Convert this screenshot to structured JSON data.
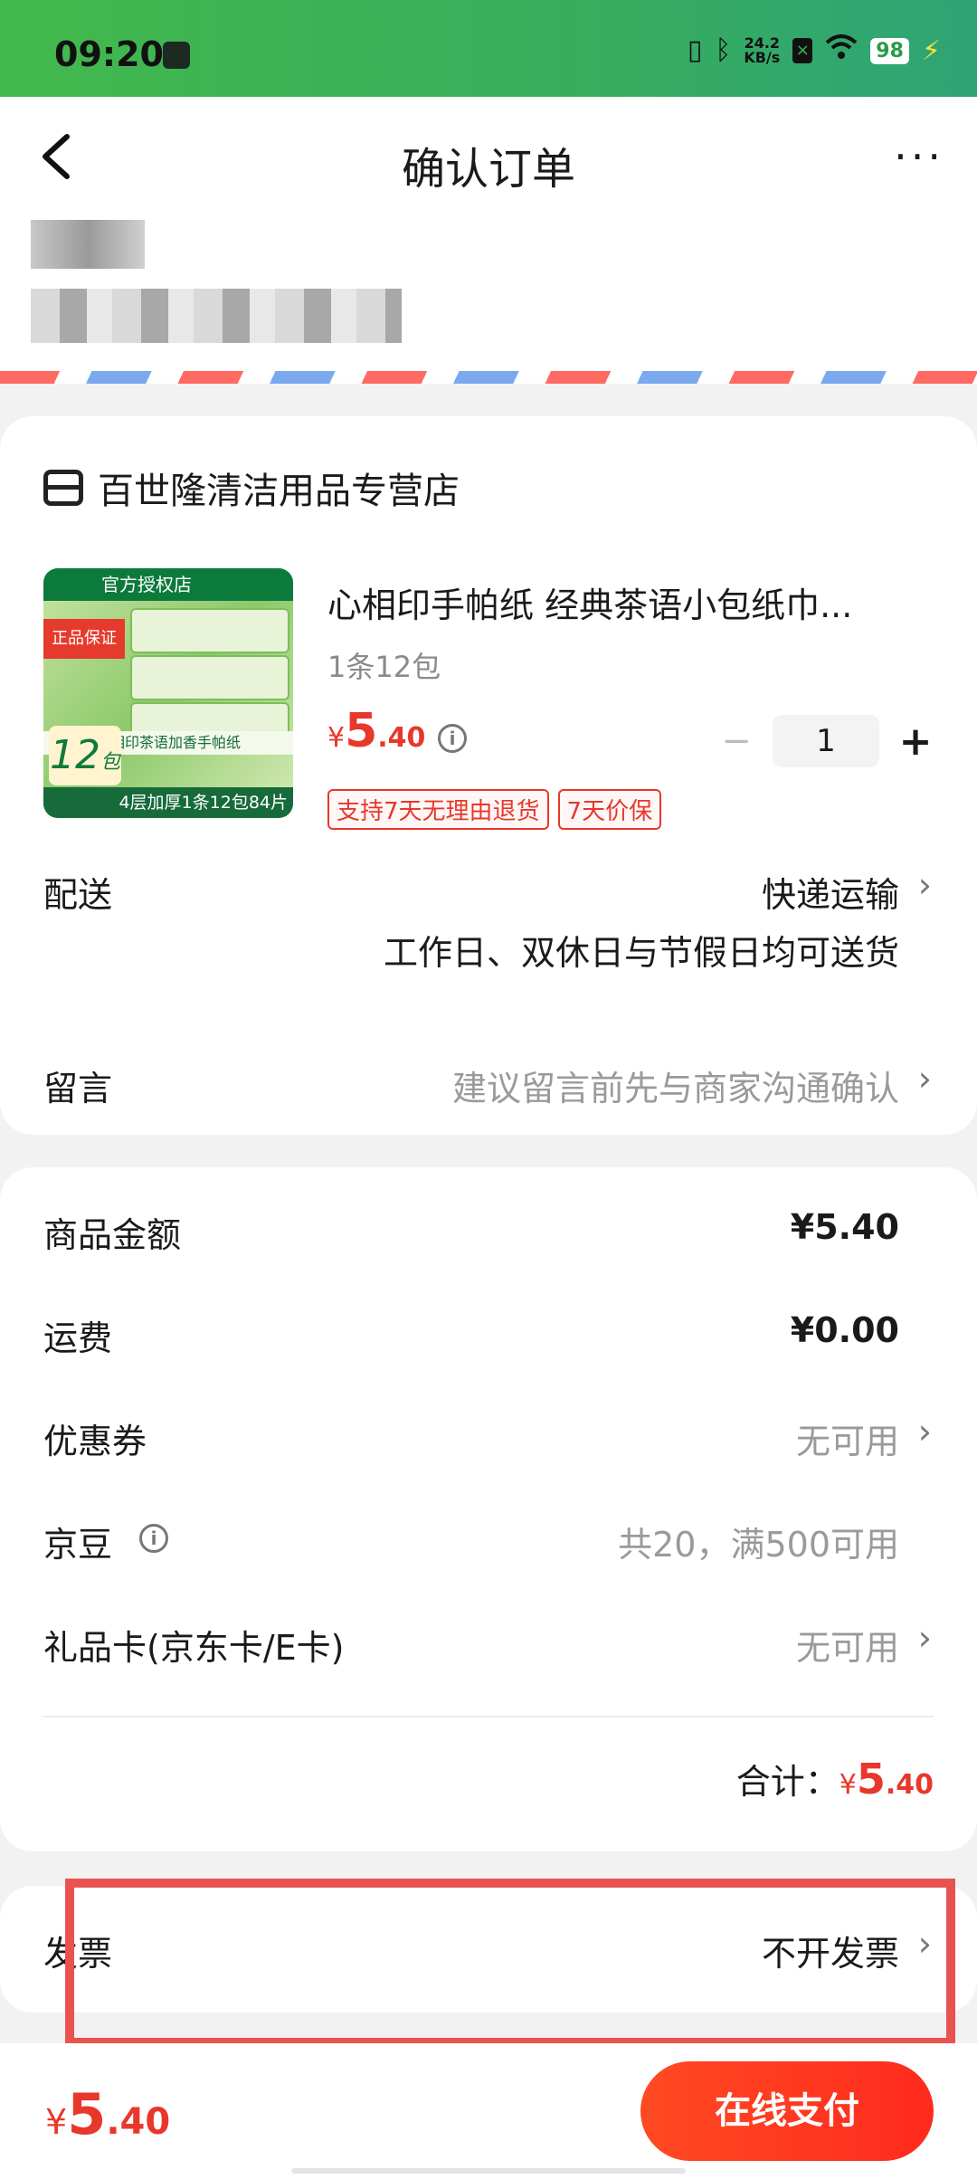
{
  "status_bar": {
    "time": "09:20",
    "net_speed_value": "24.2",
    "net_speed_unit": "KB/s",
    "battery": "98",
    "icons": [
      "vibrate-icon",
      "bluetooth-icon",
      "signal-x-icon",
      "wifi-icon",
      "battery-icon",
      "charging-icon"
    ]
  },
  "header": {
    "title": "确认订单",
    "more_label": "···"
  },
  "store": {
    "name": "百世隆清洁用品专营店"
  },
  "product": {
    "title": "心相印手帕纸 经典茶语小包纸巾...",
    "spec": "1条12包",
    "price_symbol": "¥",
    "price_int": "5",
    "price_dec": ".40",
    "quantity": "1",
    "minus": "−",
    "plus": "+",
    "tags": [
      "支持7天无理由退货",
      "7天价保"
    ],
    "image_text": {
      "top_badge": "官方授权店",
      "red_badge": "正品保证",
      "count": "12",
      "count_unit": "包",
      "line": "心相印茶语加香手帕纸",
      "bottom": "4层加厚1条12包84片"
    }
  },
  "delivery": {
    "label": "配送",
    "method": "快递运输",
    "note": "工作日、双休日与节假日均可送货"
  },
  "message": {
    "label": "留言",
    "placeholder": "建议留言前先与商家沟通确认"
  },
  "summary": {
    "goods_amount_label": "商品金额",
    "goods_amount": "¥5.40",
    "shipping_label": "运费",
    "shipping": "¥0.00",
    "coupon_label": "优惠券",
    "coupon": "无可用",
    "jingdou_label": "京豆",
    "jingdou": "共20，满500可用",
    "giftcard_label": "礼品卡(京东卡/E卡)",
    "giftcard": "无可用",
    "total_label": "合计：",
    "total_symbol": "¥",
    "total_int": "5",
    "total_dec": ".40"
  },
  "invoice": {
    "label": "发票",
    "value": "不开发票"
  },
  "bottom_bar": {
    "price_symbol": "¥",
    "price_int": "5",
    "price_dec": ".40",
    "pay_label": "在线支付"
  },
  "colors": {
    "accent_red": "#e8372b",
    "status_green": "#43b94d",
    "highlight_box": "#e8534f"
  }
}
